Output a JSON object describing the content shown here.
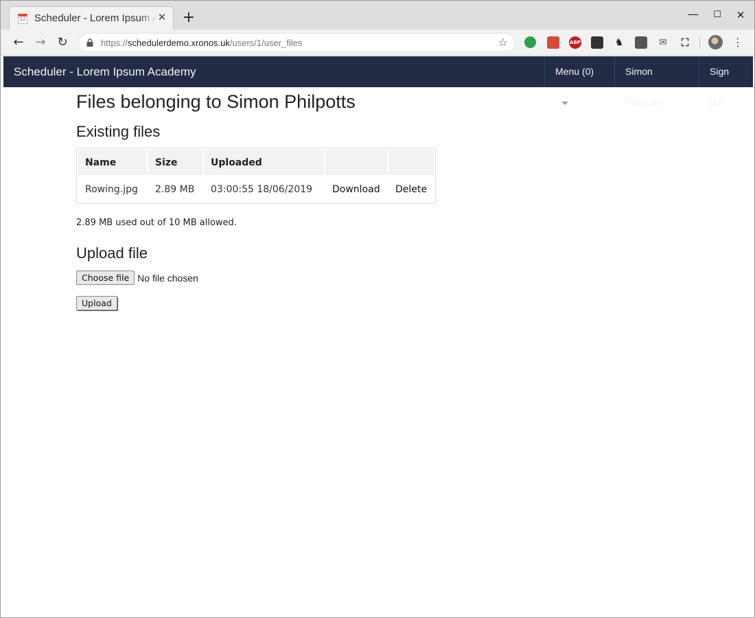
{
  "browser": {
    "tab_title": "Scheduler - Lorem Ipsum Academy",
    "tab_favicon_text": "12",
    "new_tab_label": "+",
    "url_scheme": "https://",
    "url_host": "schedulerdemo.xronos.uk",
    "url_path": "/users/1/user_files",
    "icons": {
      "back": "←",
      "forward": "→",
      "reload": "↻",
      "bookmark": "☆",
      "menu": "⋮",
      "tab_close": "✕",
      "minimize": "—",
      "maximize": "☐",
      "close": "✕"
    },
    "extensions": [
      "evernote-icon",
      "red-extension-icon",
      "adblock-plus-icon",
      "house-extension-icon",
      "gnome-extension-icon",
      "password-manager-icon",
      "mail-checker-icon",
      "screen-capture-icon"
    ],
    "extension_glyphs": {
      "abp": "ABP",
      "gnome": "♞",
      "mail": "✉",
      "capture": "⛶"
    }
  },
  "navbar": {
    "brand": "Scheduler - Lorem Ipsum Academy",
    "menu": "Menu (0)",
    "user": "Simon Philpotts",
    "sign_out": "Sign out",
    "background": "#222c45"
  },
  "page": {
    "title": "Files belonging to Simon Philpotts",
    "existing_heading": "Existing files",
    "table": {
      "headers": [
        "Name",
        "Size",
        "Uploaded",
        "",
        ""
      ],
      "rows": [
        {
          "name": "Rowing.jpg",
          "size": "2.89 MB",
          "uploaded": "03:00:55 18/06/2019",
          "download": "Download",
          "delete": "Delete"
        }
      ]
    },
    "quota": "2.89 MB used out of 10 MB allowed.",
    "upload_heading": "Upload file",
    "choose_file": "Choose file",
    "no_file": "No file chosen",
    "upload_button": "Upload"
  }
}
